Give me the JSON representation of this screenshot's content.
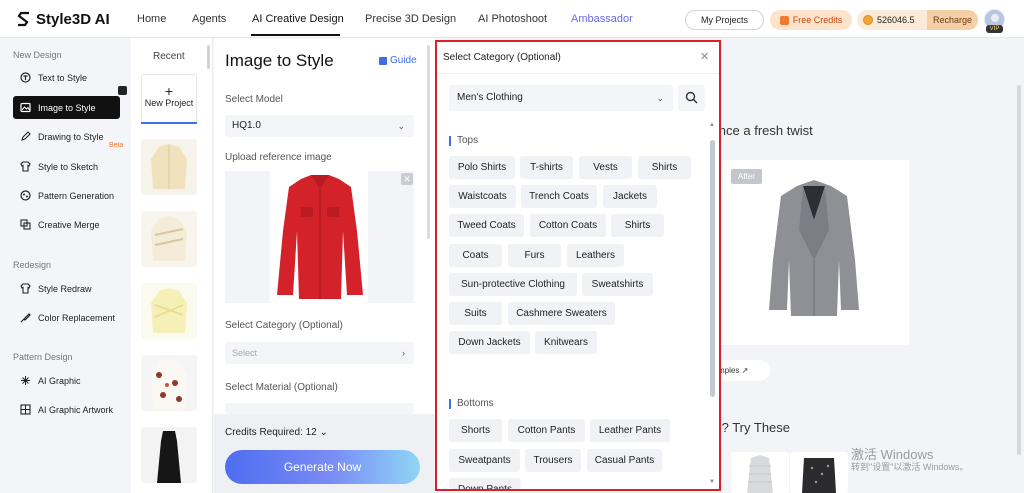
{
  "app": {
    "name": "Style3D AI"
  },
  "nav": {
    "items": [
      "Home",
      "Agents",
      "AI Creative Design",
      "Precise 3D Design",
      "AI Photoshoot",
      "Ambassador"
    ],
    "active": "AI Creative Design",
    "my_projects": "My Projects",
    "free_credits": "Free Credits",
    "credits": "526046.5",
    "recharge": "Recharge",
    "vip": "VIP"
  },
  "sidebar": {
    "groups": [
      {
        "title": "New Design",
        "items": [
          "Text to Style",
          "Image to Style",
          "Drawing to Style",
          "Style to Sketch",
          "Pattern Generation",
          "Creative Merge"
        ]
      },
      {
        "title": "Redesign",
        "items": [
          "Style Redraw",
          "Color Replacement"
        ]
      },
      {
        "title": "Pattern Design",
        "items": [
          "AI Graphic",
          "AI Graphic Artwork"
        ]
      }
    ],
    "active": "Image to Style",
    "beta_label": "Beta"
  },
  "recent": {
    "title": "Recent",
    "new_project": "New Project"
  },
  "form": {
    "title": "Image to Style",
    "guide": "Guide",
    "model_label": "Select Model",
    "model_value": "HQ1.0",
    "upload_label": "Upload reference image",
    "category_label": "Select Category (Optional)",
    "category_placeholder": "Select",
    "material_label": "Select Material (Optional)",
    "credits_required": "Credits Required: 12",
    "generate": "Generate Now"
  },
  "preview": {
    "heading": "erence a fresh twist",
    "after_badge": "After",
    "samples": "mples",
    "try_heading": "I? Try These",
    "watermark_line1": "激活 Windows",
    "watermark_line2": "转到\"设置\"以激活 Windows。"
  },
  "modal": {
    "title": "Select Category (Optional)",
    "select_value": "Men's Clothing",
    "sections": [
      {
        "title": "Tops",
        "tags": [
          "Polo Shirts",
          "T-shirts",
          "Vests",
          "Shirts",
          "Waistcoats",
          "Trench Coats",
          "Jackets",
          "Tweed Coats",
          "Cotton Coats",
          "Shirts",
          "Coats",
          "Furs",
          "Leathers",
          "Sun-protective Clothing",
          "Sweatshirts",
          "Suits",
          "Cashmere Sweaters",
          "Down Jackets",
          "Knitwears"
        ]
      },
      {
        "title": "Bottoms",
        "tags": [
          "Shorts",
          "Cotton Pants",
          "Leather Pants",
          "Sweatpants",
          "Trousers",
          "Casual Pants",
          "Down Pants"
        ]
      }
    ]
  },
  "colors": {
    "accent": "#3d6ee3",
    "highlight_border": "#d9202a",
    "credit_orange": "#f07a2e"
  }
}
